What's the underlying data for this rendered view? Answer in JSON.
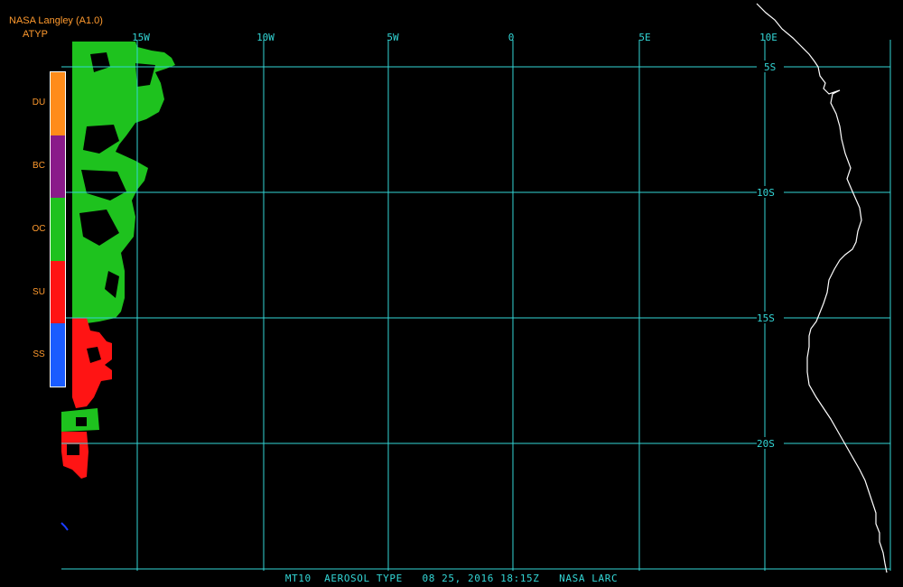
{
  "header": {
    "title": "NASA Langley (A1.0)",
    "product_code": "ATYP"
  },
  "map": {
    "longitude_labels": [
      "15W",
      "10W",
      "5W",
      "0",
      "5E",
      "10E"
    ],
    "latitude_labels": [
      "5S",
      "10S",
      "15S",
      "20S"
    ],
    "colors": {
      "grid": "#33d6d6",
      "coastline": "#ffffff",
      "background": "#000000"
    }
  },
  "legend": {
    "items": [
      {
        "label": "DU",
        "color": "#ff8c1a"
      },
      {
        "label": "BC",
        "color": "#8a1a8a"
      },
      {
        "label": "OC",
        "color": "#1ec21e"
      },
      {
        "label": "SU",
        "color": "#ff1414"
      },
      {
        "label": "SS",
        "color": "#1a5cff"
      }
    ]
  },
  "footer": {
    "text": "MT10  AEROSOL TYPE   08 25, 2016 18:15Z   NASA LARC"
  }
}
